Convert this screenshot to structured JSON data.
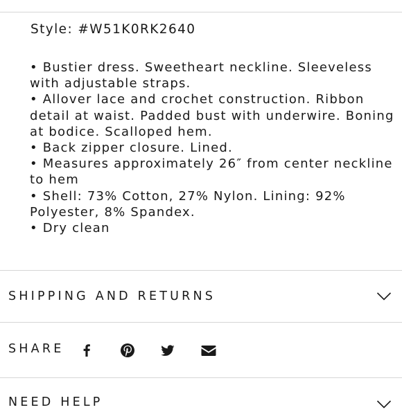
{
  "product": {
    "style_line": "Style: #W51K0RK2640",
    "details": [
      {
        "lines": [
          "• Bustier dress. Sweetheart neckline. Sleeveless",
          "with adjustable straps."
        ]
      },
      {
        "lines": [
          "• Allover lace and crochet construction. Ribbon",
          "detail at waist. Padded bust with underwire. Boning",
          "at bodice. Scalloped hem."
        ]
      },
      {
        "lines": [
          "• Back zipper closure. Lined."
        ]
      },
      {
        "lines": [
          "• Measures approximately 26″ from center neckline",
          "to hem"
        ]
      },
      {
        "lines": [
          "• Shell: 73% Cotton, 27% Nylon. Lining: 92%",
          "Polyester, 8% Spandex."
        ]
      },
      {
        "lines": [
          "• Dry clean"
        ]
      }
    ]
  },
  "accordion": {
    "shipping_label": "SHIPPING AND RETURNS",
    "shipping_icon": "chevron-down-icon",
    "need_help_label": "NEED HELP"
  },
  "share": {
    "label": "SHARE",
    "icons": [
      "facebook-icon",
      "pinterest-icon",
      "twitter-icon",
      "email-icon"
    ]
  },
  "colors": {
    "text": "#1a1a1a",
    "divider": "#d6d6d6",
    "background": "#ffffff"
  }
}
